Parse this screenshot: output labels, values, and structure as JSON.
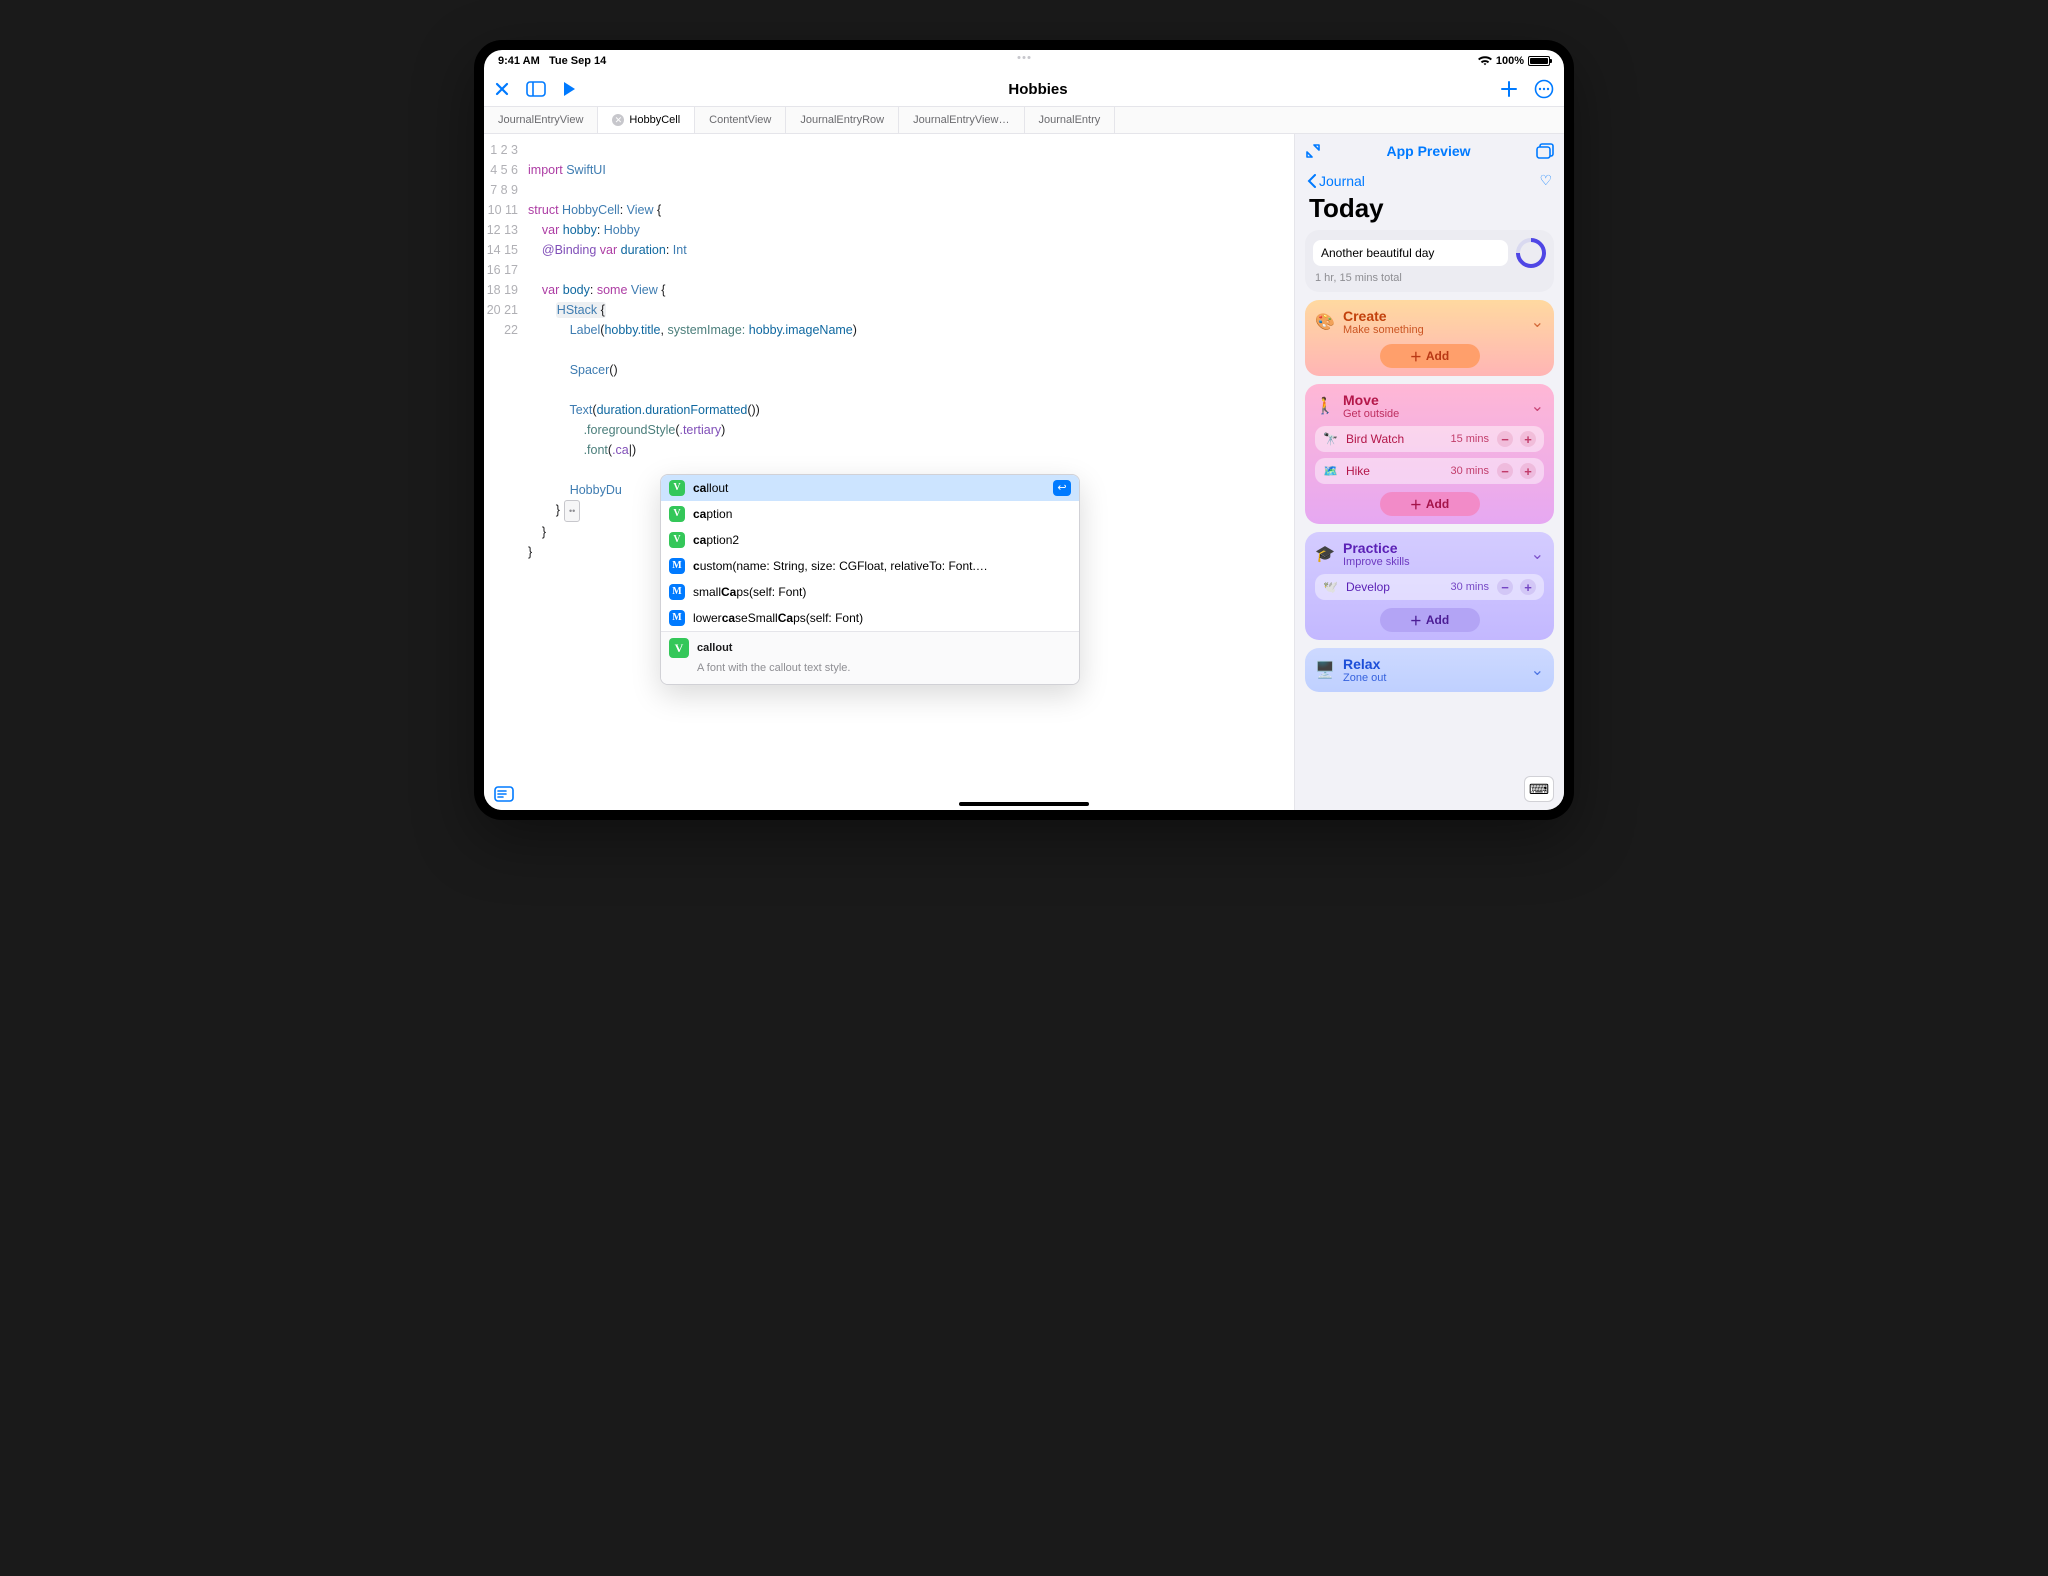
{
  "status": {
    "time": "9:41 AM",
    "date": "Tue Sep 14",
    "battery": "100%"
  },
  "toolbar": {
    "title": "Hobbies"
  },
  "tabs": [
    {
      "label": "JournalEntryView"
    },
    {
      "label": "HobbyCell",
      "active": true
    },
    {
      "label": "ContentView"
    },
    {
      "label": "JournalEntryRow"
    },
    {
      "label": "JournalEntryView…"
    },
    {
      "label": "JournalEntry"
    }
  ],
  "code": {
    "lines": 22,
    "tokens": {
      "import": "import",
      "swiftui": "SwiftUI",
      "struct": "struct",
      "hobbycell": "HobbyCell",
      "view": "View",
      "var": "var",
      "hobby": "hobby",
      "hobbytype": "Hobby",
      "binding": "@Binding",
      "duration": "duration",
      "int": "Int",
      "body": "body",
      "some": "some",
      "hstack": "HStack",
      "label": "Label",
      "htitle": "hobby.title",
      "sysimg": "systemImage:",
      "himg": "hobby.imageName",
      "spacer": "Spacer",
      "text": "Text",
      "durf": "duration.durationFormatted",
      "fgs": ".foregroundStyle",
      "tert": ".tertiary",
      "font": ".font",
      "ca": ".ca",
      "hobbydu": "HobbyDu"
    }
  },
  "ac": {
    "items": [
      {
        "kind": "V",
        "prefix": "ca",
        "rest": "llout",
        "sel": true
      },
      {
        "kind": "V",
        "prefix": "ca",
        "rest": "ption"
      },
      {
        "kind": "V",
        "prefix": "ca",
        "rest": "ption2"
      },
      {
        "kind": "M",
        "prefix": "c",
        "rest": "ustom(name: String, size: CGFloat, relativeTo: Font.…"
      },
      {
        "kind": "M",
        "pre": "small",
        "prefix": "Ca",
        "rest": "ps(self: Font)"
      },
      {
        "kind": "M",
        "pre": "lower",
        "prefix": "ca",
        "mid": "seSmall",
        "prefix2": "Ca",
        "rest": "ps(self: Font)"
      }
    ],
    "detail": {
      "kind": "V",
      "title": "callout",
      "desc": "A font with the callout text style."
    }
  },
  "preview": {
    "title": "App Preview",
    "back": "Journal",
    "heading": "Today",
    "today": {
      "text": "Another beautiful day",
      "sub": "1 hr, 15 mins total"
    },
    "addLabel": "Add",
    "sections": [
      {
        "id": "create",
        "icon": "🎨",
        "title": "Create",
        "sub": "Make something",
        "rows": []
      },
      {
        "id": "move",
        "icon": "🚶",
        "title": "Move",
        "sub": "Get outside",
        "rows": [
          {
            "icon": "🔭",
            "label": "Bird Watch",
            "dur": "15 mins"
          },
          {
            "icon": "🗺️",
            "label": "Hike",
            "dur": "30 mins"
          }
        ]
      },
      {
        "id": "practice",
        "icon": "🎓",
        "title": "Practice",
        "sub": "Improve skills",
        "rows": [
          {
            "icon": "🕊️",
            "label": "Develop",
            "dur": "30 mins"
          }
        ]
      },
      {
        "id": "relax",
        "icon": "🖥️",
        "title": "Relax",
        "sub": "Zone out",
        "rows": []
      }
    ]
  }
}
